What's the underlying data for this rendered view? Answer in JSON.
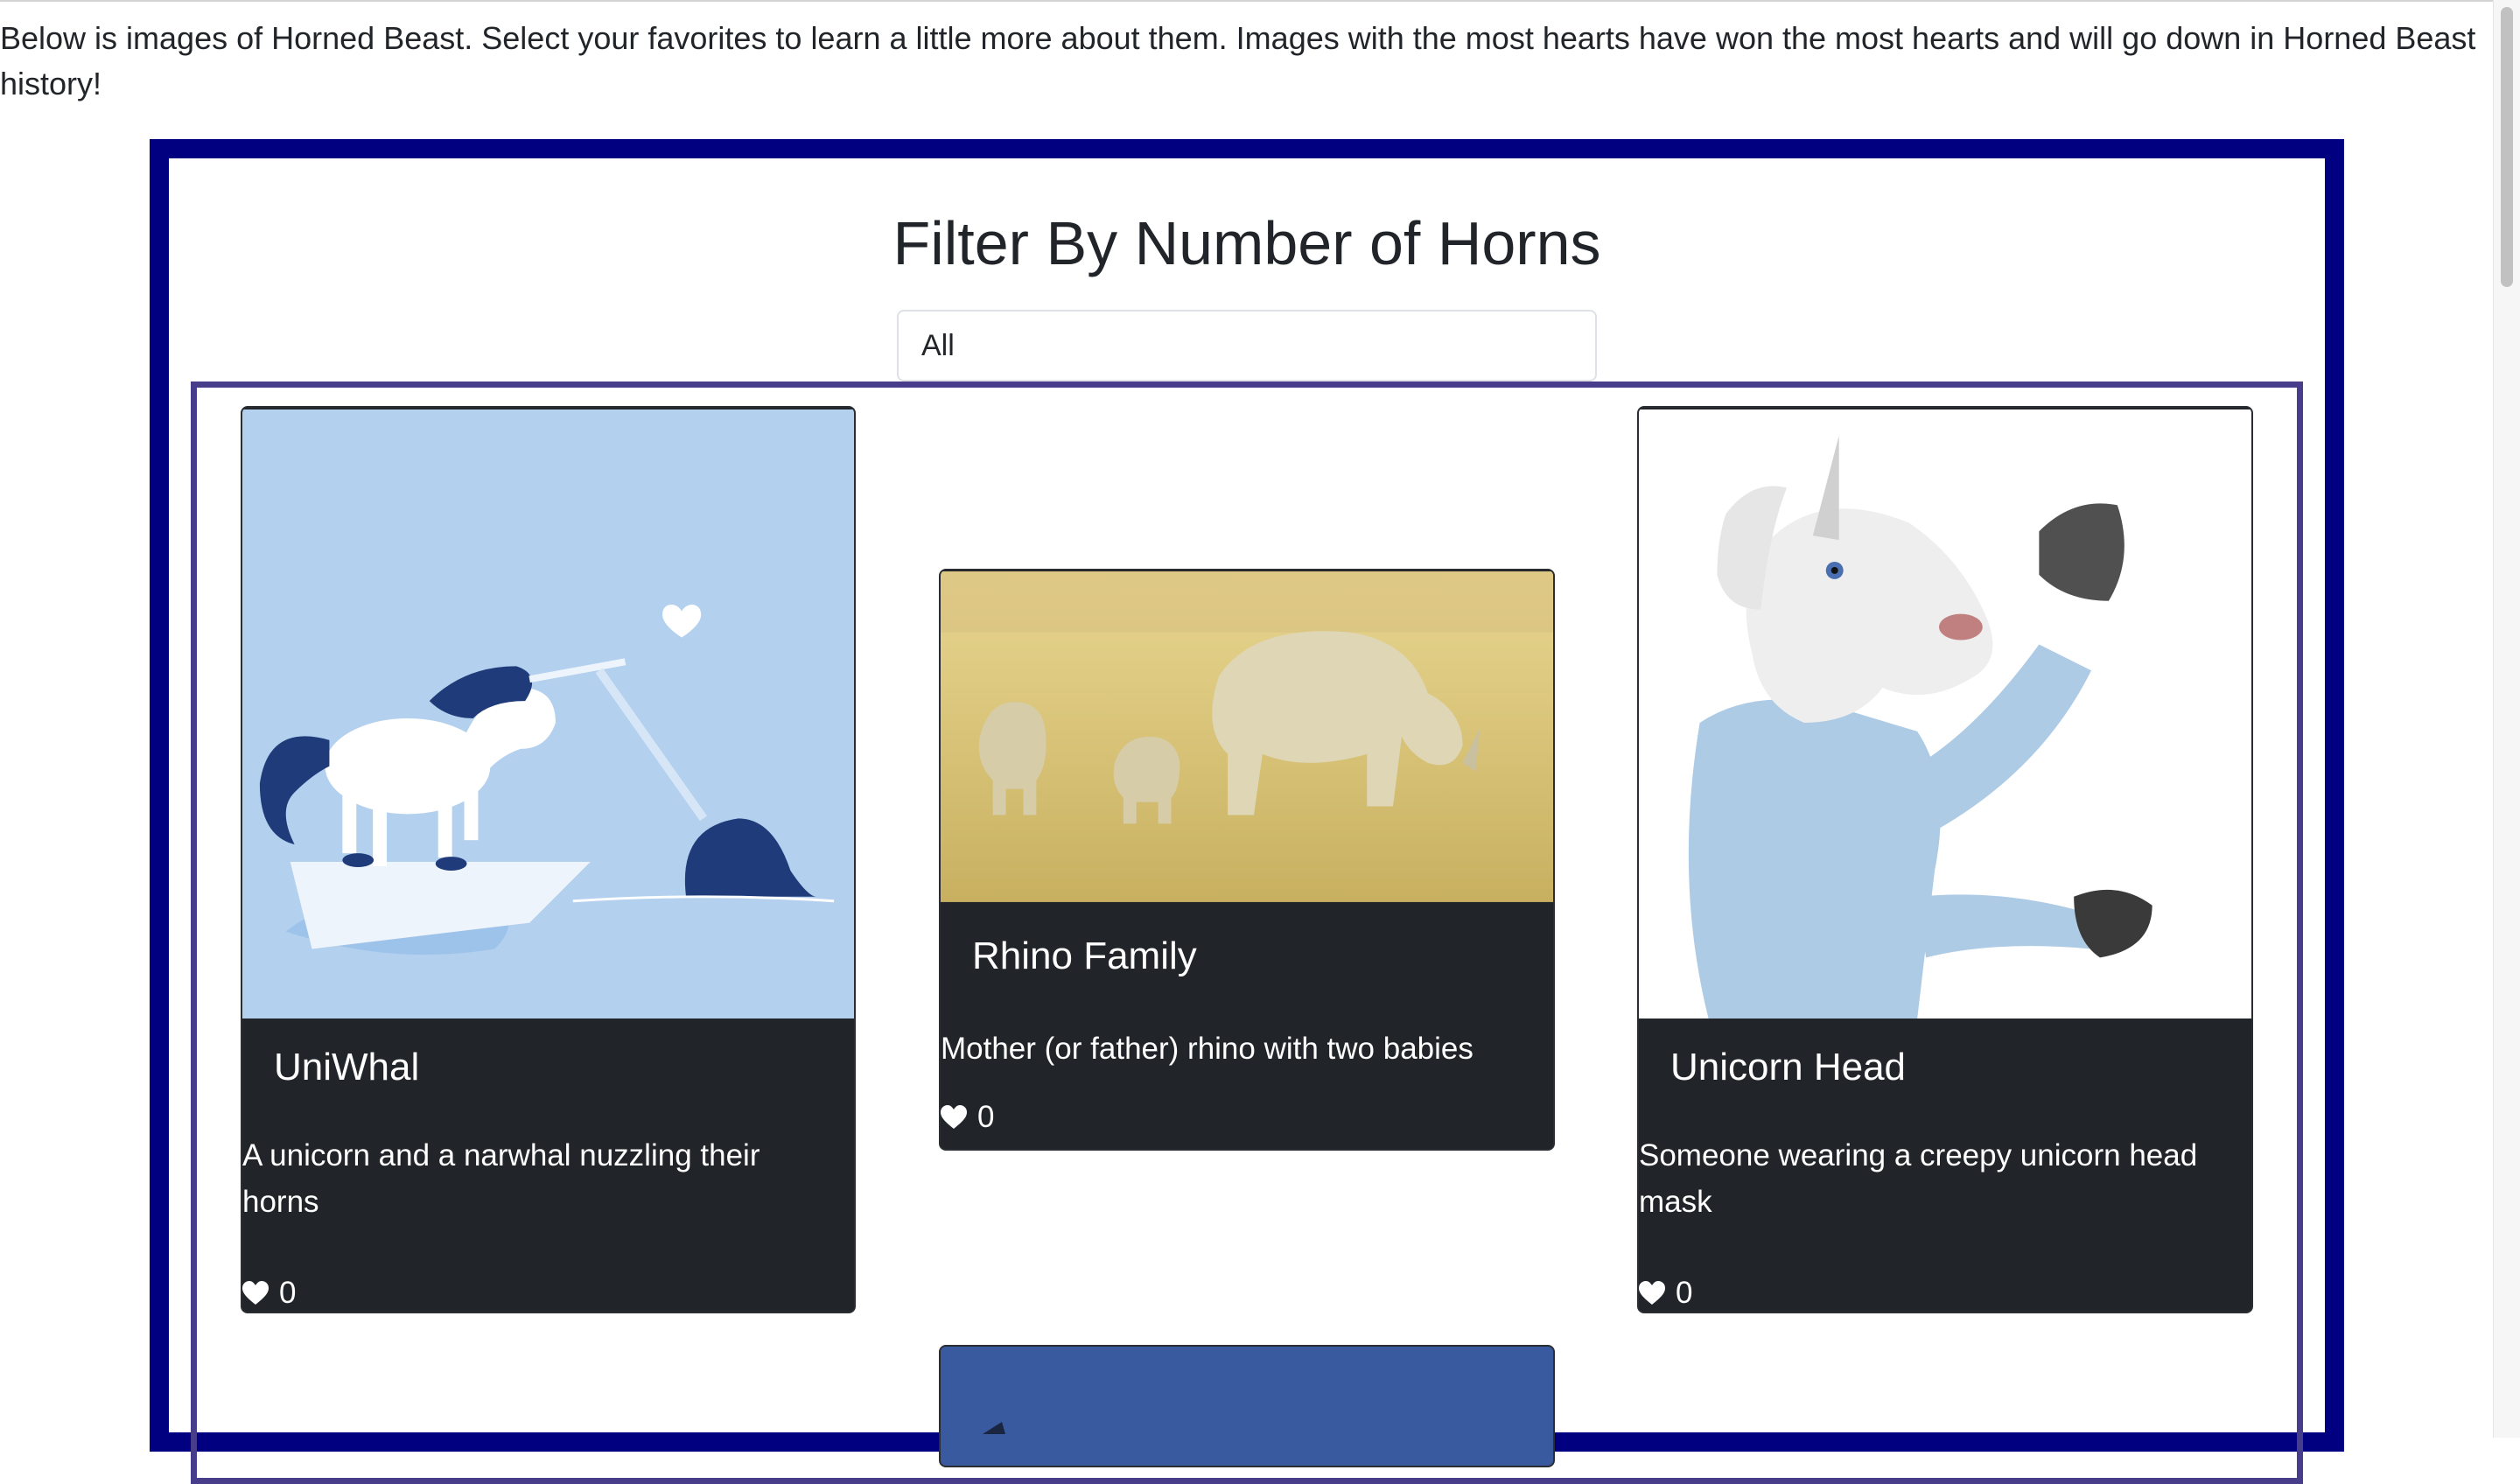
{
  "intro_text": "Below is images of Horned Beast. Select your favorites to learn a little more about them. Images with the most hearts have won the most hearts and will go down in Horned Beast history!",
  "filter": {
    "heading": "Filter By Number of Horns",
    "selected": "All"
  },
  "cards": [
    {
      "title": "UniWhal",
      "description": "A unicorn and a narwhal nuzzling their horns",
      "likes": "0"
    },
    {
      "title": "Rhino Family",
      "description": "Mother (or father) rhino with two babies",
      "likes": "0"
    },
    {
      "title": "Unicorn Head",
      "description": "Someone wearing a creepy unicorn head mask",
      "likes": "0"
    }
  ],
  "icons": {
    "like": "heart-icon"
  },
  "colors": {
    "outer_border": "#000080",
    "inner_border": "#483d8b",
    "card_body": "#212529",
    "uniwhal_bg": "#b3d1ee",
    "fourth_card_bg": "#3a5aa0"
  }
}
